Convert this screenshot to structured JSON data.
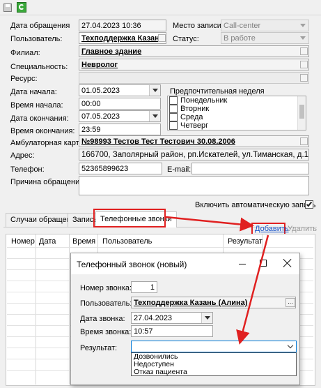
{
  "form": {
    "date_label": "Дата обращения",
    "date_value": "27.04.2023 10:36",
    "place_label": "Место записи:",
    "place_value": "Call-center",
    "user_label": "Пользователь:",
    "user_value": "Техподдержка Казань",
    "status_label": "Статус:",
    "status_value": "В работе",
    "branch_label": "Филиал:",
    "branch_value": "Главное здание",
    "specialty_label": "Специальность:",
    "specialty_value": "Невролог",
    "resource_label": "Ресурс:",
    "start_date_label": "Дата начала:",
    "start_date_value": "01.05.2023",
    "start_time_label": "Время начала:",
    "start_time_value": "00:00",
    "end_date_label": "Дата окончания:",
    "end_date_value": "07.05.2023",
    "end_time_label": "Время окончания:",
    "end_time_value": "23:59",
    "week_label": "Предпочтительная неделя",
    "week_days": [
      "Понедельник",
      "Вторник",
      "Среда",
      "Четверг"
    ],
    "card_label": "Амбулаторная карта:",
    "card_value": "№98993 Тестов Тест Тестович 30.08.2006",
    "address_label": "Адрес:",
    "address_value": "166700, Заполярный район, рп.Искателей, ул.Тиманская, д.1,",
    "phone_label": "Телефон:",
    "phone_value": "52365899623",
    "email_label": "E-mail:",
    "reason_label": "Причина обращения:",
    "auto_label": "Включить автоматическую запись"
  },
  "tabs": [
    "Случаи обращения",
    "Запись",
    "Телефонные звонки"
  ],
  "actions": {
    "add": "Добавить",
    "delete": "Удалить"
  },
  "table": {
    "headers": [
      "Номер",
      "Дата",
      "Время",
      "Пользователь",
      "Результат"
    ]
  },
  "dialog": {
    "title": "Телефонный звонок (новый)",
    "number_label": "Номер звонка:",
    "number_value": "1",
    "user_label": "Пользователь:",
    "user_value": "Техподдержка Казань (Алина)",
    "user_btn": "...",
    "date_label": "Дата звонка:",
    "date_value": "27.04.2023",
    "time_label": "Время звонка:",
    "time_value": "10:57",
    "result_label": "Результат:",
    "result_options": [
      "Дозвонились",
      "Недоступен",
      "Отказ пациента"
    ]
  },
  "colors": {
    "highlight": "#e02020",
    "link": "#1a55c8",
    "accent": "#0078d7"
  }
}
